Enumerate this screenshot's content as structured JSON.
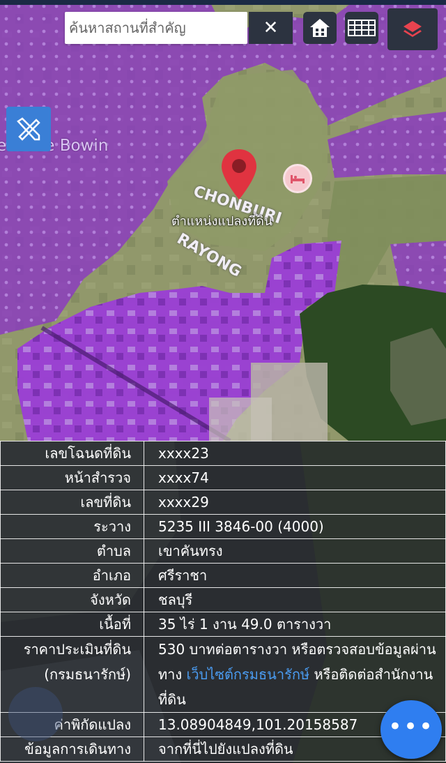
{
  "search": {
    "placeholder": "ค้นหาสถานที่สำคัญ",
    "value": ""
  },
  "toolbar": {
    "clear_icon": "close-icon",
    "home_icon": "home-icon",
    "grid_icon": "grid-icon",
    "layers_icon": "layers-icon",
    "ruler_icon": "ruler-pencil-icon"
  },
  "map": {
    "labels": {
      "warehouse": "rehouse Bowin",
      "chonburi": "CHONBURI",
      "rayong": "RAYONG",
      "parcel_marker": "ตำแหน่งแปลงที่ดิน"
    },
    "colors": {
      "zone_purple": "#9b3fd6",
      "pin_red": "#e03340"
    }
  },
  "info": {
    "rows": [
      {
        "label": "เลขโฉนดที่ดิน",
        "value": "xxxx23"
      },
      {
        "label": "หน้าสำรวจ",
        "value": "xxxx74"
      },
      {
        "label": "เลขที่ดิน",
        "value": "xxxx29"
      },
      {
        "label": "ระวาง",
        "value": "5235 III 3846-00 (4000)"
      },
      {
        "label": "ตำบล",
        "value": "เขาคันทรง"
      },
      {
        "label": "อำเภอ",
        "value": "ศรีราชา"
      },
      {
        "label": "จังหวัด",
        "value": "ชลบุรี"
      },
      {
        "label": "เนื้อที่",
        "value": "35 ไร่ 1 งาน 49.0 ตารางวา"
      }
    ],
    "appraisal": {
      "label_line1": "ราคาประเมินที่ดิน",
      "label_line2": "(กรมธนารักษ์)",
      "text_part1": "530 บาทต่อตารางวา หรือตรวจสอบข้อมูลผ่านทาง",
      "link_text": "เว็บไซต์กรมธนารักษ์",
      "text_part2": "หรือติดต่อสำนักงานที่ดิน"
    },
    "coords": {
      "label": "ค่าพิกัดแปลง",
      "value": "13.08904849,101.20158587"
    },
    "directions": {
      "label": "ข้อมูลการเดินทาง",
      "value": "จากที่นี่ไปยังแปลงที่ดิน"
    }
  },
  "fab": {
    "label": "•••"
  }
}
